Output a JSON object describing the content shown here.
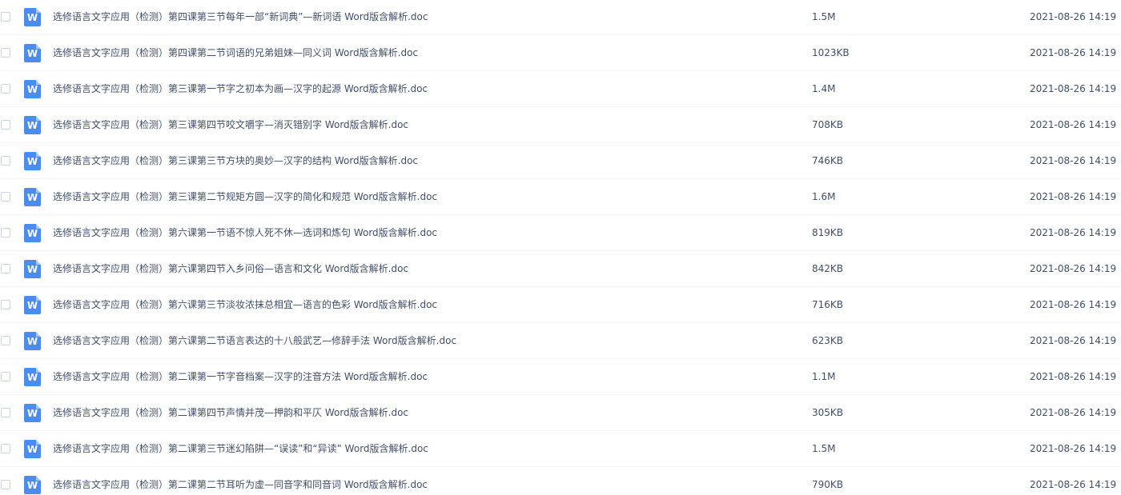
{
  "files": [
    {
      "name": "选修语言文字应用（检测）第四课第三节每年一部“新词典”—新词语 Word版含解析.doc",
      "size": "1.5M",
      "modified": "2021-08-26 14:19",
      "icon": "word-doc-icon",
      "icon_letter": "W"
    },
    {
      "name": "选修语言文字应用（检测）第四课第二节词语的兄弟姐妹—同义词 Word版含解析.doc",
      "size": "1023KB",
      "modified": "2021-08-26 14:19",
      "icon": "word-doc-icon",
      "icon_letter": "W"
    },
    {
      "name": "选修语言文字应用（检测）第三课第一节字之初本为画—汉字的起源 Word版含解析.doc",
      "size": "1.4M",
      "modified": "2021-08-26 14:19",
      "icon": "word-doc-icon",
      "icon_letter": "W"
    },
    {
      "name": "选修语言文字应用（检测）第三课第四节咬文嚼字—消灭错别字 Word版含解析.doc",
      "size": "708KB",
      "modified": "2021-08-26 14:19",
      "icon": "word-doc-icon",
      "icon_letter": "W"
    },
    {
      "name": "选修语言文字应用（检测）第三课第三节方块的奥妙—汉字的结构 Word版含解析.doc",
      "size": "746KB",
      "modified": "2021-08-26 14:19",
      "icon": "word-doc-icon",
      "icon_letter": "W"
    },
    {
      "name": "选修语言文字应用（检测）第三课第二节规矩方圆—汉字的简化和规范 Word版含解析.doc",
      "size": "1.6M",
      "modified": "2021-08-26 14:19",
      "icon": "word-doc-icon",
      "icon_letter": "W"
    },
    {
      "name": "选修语言文字应用（检测）第六课第一节语不惊人死不休—选词和炼句 Word版含解析.doc",
      "size": "819KB",
      "modified": "2021-08-26 14:19",
      "icon": "word-doc-icon",
      "icon_letter": "W"
    },
    {
      "name": "选修语言文字应用（检测）第六课第四节入乡问俗—语言和文化 Word版含解析.doc",
      "size": "842KB",
      "modified": "2021-08-26 14:19",
      "icon": "word-doc-icon",
      "icon_letter": "W"
    },
    {
      "name": "选修语言文字应用（检测）第六课第三节淡妆浓抹总相宜—语言的色彩 Word版含解析.doc",
      "size": "716KB",
      "modified": "2021-08-26 14:19",
      "icon": "word-doc-icon",
      "icon_letter": "W"
    },
    {
      "name": "选修语言文字应用（检测）第六课第二节语言表达的十八般武艺—修辞手法 Word版含解析.doc",
      "size": "623KB",
      "modified": "2021-08-26 14:19",
      "icon": "word-doc-icon",
      "icon_letter": "W"
    },
    {
      "name": "选修语言文字应用（检测）第二课第一节字音档案—汉字的注音方法 Word版含解析.doc",
      "size": "1.1M",
      "modified": "2021-08-26 14:19",
      "icon": "word-doc-icon",
      "icon_letter": "W"
    },
    {
      "name": "选修语言文字应用（检测）第二课第四节声情并茂—押韵和平仄 Word版含解析.doc",
      "size": "305KB",
      "modified": "2021-08-26 14:19",
      "icon": "word-doc-icon",
      "icon_letter": "W"
    },
    {
      "name": "选修语言文字应用（检测）第二课第三节迷幻陷阱—“误读”和“异读” Word版含解析.doc",
      "size": "1.5M",
      "modified": "2021-08-26 14:19",
      "icon": "word-doc-icon",
      "icon_letter": "W"
    },
    {
      "name": "选修语言文字应用（检测）第二课第二节耳听为虚—同音字和同音词 Word版含解析.doc",
      "size": "790KB",
      "modified": "2021-08-26 14:19",
      "icon": "word-doc-icon",
      "icon_letter": "W"
    }
  ],
  "colors": {
    "text": "#424e67",
    "icon_blue": "#4a8cf0",
    "row_divider": "#f2f4f7",
    "checkbox_border": "#cdd3df"
  }
}
